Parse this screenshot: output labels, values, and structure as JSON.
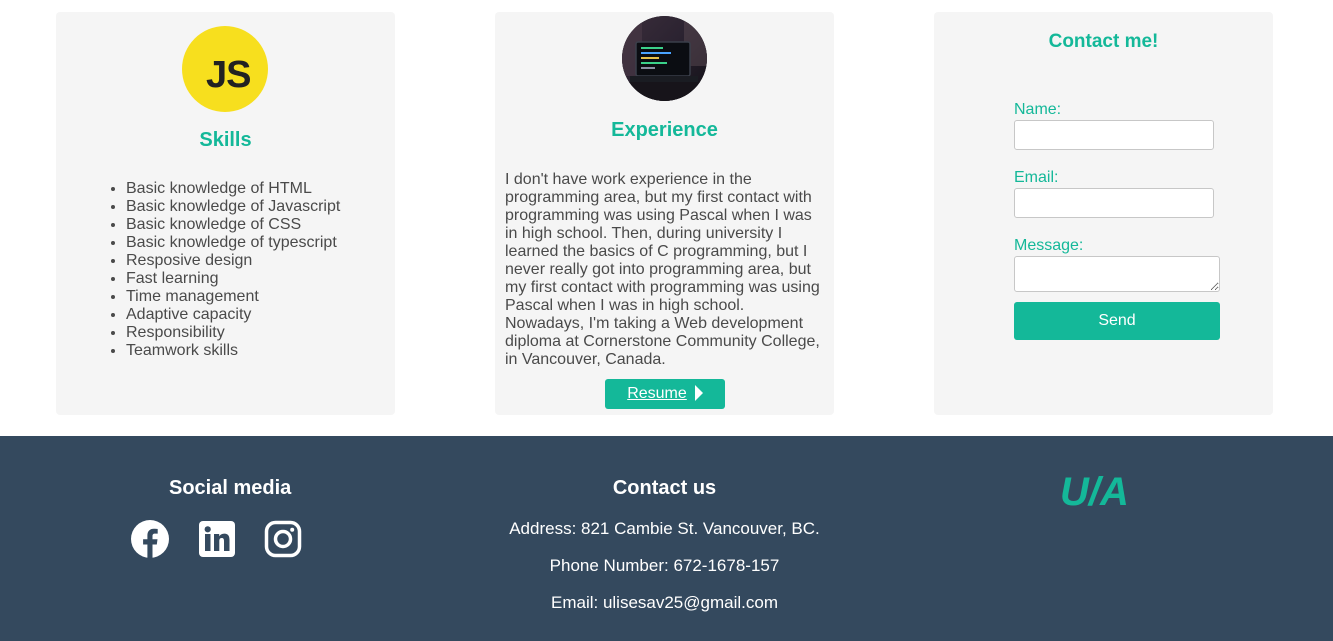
{
  "skills": {
    "logo_text": "JS",
    "title": "Skills",
    "items": [
      "Basic knowledge of HTML",
      "Basic knowledge of Javascript",
      "Basic knowledge of CSS",
      "Basic knowledge of typescript",
      "Resposive design",
      "Fast learning",
      "Time management",
      "Adaptive capacity",
      "Responsibility",
      "Teamwork skills"
    ]
  },
  "experience": {
    "title": "Experience",
    "text": "I don't have work experience in the programming area, but my first contact with programming was using Pascal when I was in high school. Then, during university I learned the basics of C programming, but I never really got into programming area, but my first contact with programming was using Pascal when I was in high school. Nowadays, I'm taking a Web development diploma at Cornerstone Community College, in Vancouver, Canada.",
    "resume_label": "Resume"
  },
  "contact_form": {
    "title": "Contact me!",
    "name_label": "Name:",
    "name_value": "",
    "email_label": "Email:",
    "email_value": "",
    "message_label": "Message:",
    "message_value": "",
    "send_label": "Send"
  },
  "footer": {
    "social_title": "Social media",
    "social_icons": [
      "facebook-icon",
      "linkedin-icon",
      "instagram-icon"
    ],
    "contact_title": "Contact us",
    "address": "Address: 821 Cambie St. Vancouver, BC.",
    "phone": "Phone Number: 672-1678-157",
    "email": "Email: ulisesav25@gmail.com",
    "brand": "U/A"
  },
  "colors": {
    "accent": "#14b899",
    "card_bg": "#f5f5f5",
    "footer_bg": "#34495e",
    "js_yellow": "#f7df1e"
  }
}
